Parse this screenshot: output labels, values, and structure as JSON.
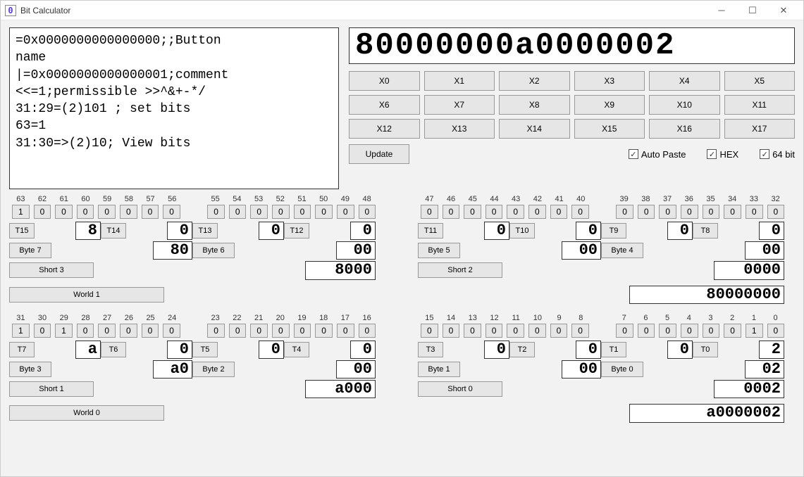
{
  "window": {
    "title": "Bit Calculator"
  },
  "script_text": "=0x0000000000000000;;Button\nname\n|=0x0000000000000001;comment\n<<=1;permissible >>^&+-*/\n31:29=(2)101 ; set bits\n63=1\n31:30=>(2)10; View bits",
  "main_value": "80000000a0000002",
  "x_buttons": [
    "X0",
    "X1",
    "X2",
    "X3",
    "X4",
    "X5",
    "X6",
    "X7",
    "X8",
    "X9",
    "X10",
    "X11",
    "X12",
    "X13",
    "X14",
    "X15",
    "X16",
    "X17"
  ],
  "update_label": "Update",
  "checkboxes": {
    "auto_paste": "Auto Paste",
    "hex": "HEX",
    "b64": "64 bit"
  },
  "upper": {
    "left": {
      "bit_labels": [
        "63",
        "62",
        "61",
        "60",
        "59",
        "58",
        "57",
        "56",
        "55",
        "54",
        "53",
        "52",
        "51",
        "50",
        "49",
        "48"
      ],
      "bit_values": [
        "1",
        "0",
        "0",
        "0",
        "0",
        "0",
        "0",
        "0",
        "0",
        "0",
        "0",
        "0",
        "0",
        "0",
        "0",
        "0"
      ],
      "nibbles": [
        {
          "btn": "T15",
          "val": "8"
        },
        {
          "btn": "T14",
          "val": "0"
        },
        {
          "btn": "T13",
          "val": "0"
        },
        {
          "btn": "T12",
          "val": "0"
        }
      ],
      "bytes": [
        {
          "btn": "Byte 7",
          "val": "80"
        },
        {
          "btn": "Byte 6",
          "val": "00"
        }
      ],
      "short": {
        "btn": "Short 3",
        "val": "8000"
      }
    },
    "right": {
      "bit_labels": [
        "47",
        "46",
        "45",
        "44",
        "43",
        "42",
        "41",
        "40",
        "39",
        "38",
        "37",
        "36",
        "35",
        "34",
        "33",
        "32"
      ],
      "bit_values": [
        "0",
        "0",
        "0",
        "0",
        "0",
        "0",
        "0",
        "0",
        "0",
        "0",
        "0",
        "0",
        "0",
        "0",
        "0",
        "0"
      ],
      "nibbles": [
        {
          "btn": "T11",
          "val": "0"
        },
        {
          "btn": "T10",
          "val": "0"
        },
        {
          "btn": "T9",
          "val": "0"
        },
        {
          "btn": "T8",
          "val": "0"
        }
      ],
      "bytes": [
        {
          "btn": "Byte 5",
          "val": "00"
        },
        {
          "btn": "Byte 4",
          "val": "00"
        }
      ],
      "short": {
        "btn": "Short 2",
        "val": "0000"
      }
    },
    "world": {
      "btn": "World 1",
      "val": "80000000"
    }
  },
  "lower": {
    "left": {
      "bit_labels": [
        "31",
        "30",
        "29",
        "28",
        "27",
        "26",
        "25",
        "24",
        "23",
        "22",
        "21",
        "20",
        "19",
        "18",
        "17",
        "16"
      ],
      "bit_values": [
        "1",
        "0",
        "1",
        "0",
        "0",
        "0",
        "0",
        "0",
        "0",
        "0",
        "0",
        "0",
        "0",
        "0",
        "0",
        "0"
      ],
      "nibbles": [
        {
          "btn": "T7",
          "val": "a"
        },
        {
          "btn": "T6",
          "val": "0"
        },
        {
          "btn": "T5",
          "val": "0"
        },
        {
          "btn": "T4",
          "val": "0"
        }
      ],
      "bytes": [
        {
          "btn": "Byte 3",
          "val": "a0"
        },
        {
          "btn": "Byte 2",
          "val": "00"
        }
      ],
      "short": {
        "btn": "Short 1",
        "val": "a000"
      }
    },
    "right": {
      "bit_labels": [
        "15",
        "14",
        "13",
        "12",
        "11",
        "10",
        "9",
        "8",
        "7",
        "6",
        "5",
        "4",
        "3",
        "2",
        "1",
        "0"
      ],
      "bit_values": [
        "0",
        "0",
        "0",
        "0",
        "0",
        "0",
        "0",
        "0",
        "0",
        "0",
        "0",
        "0",
        "0",
        "0",
        "1",
        "0"
      ],
      "nibbles": [
        {
          "btn": "T3",
          "val": "0"
        },
        {
          "btn": "T2",
          "val": "0"
        },
        {
          "btn": "T1",
          "val": "0"
        },
        {
          "btn": "T0",
          "val": "2"
        }
      ],
      "bytes": [
        {
          "btn": "Byte 1",
          "val": "00"
        },
        {
          "btn": "Byte 0",
          "val": "02"
        }
      ],
      "short": {
        "btn": "Short 0",
        "val": "0002"
      }
    },
    "world": {
      "btn": "World 0",
      "val": "a0000002"
    }
  }
}
